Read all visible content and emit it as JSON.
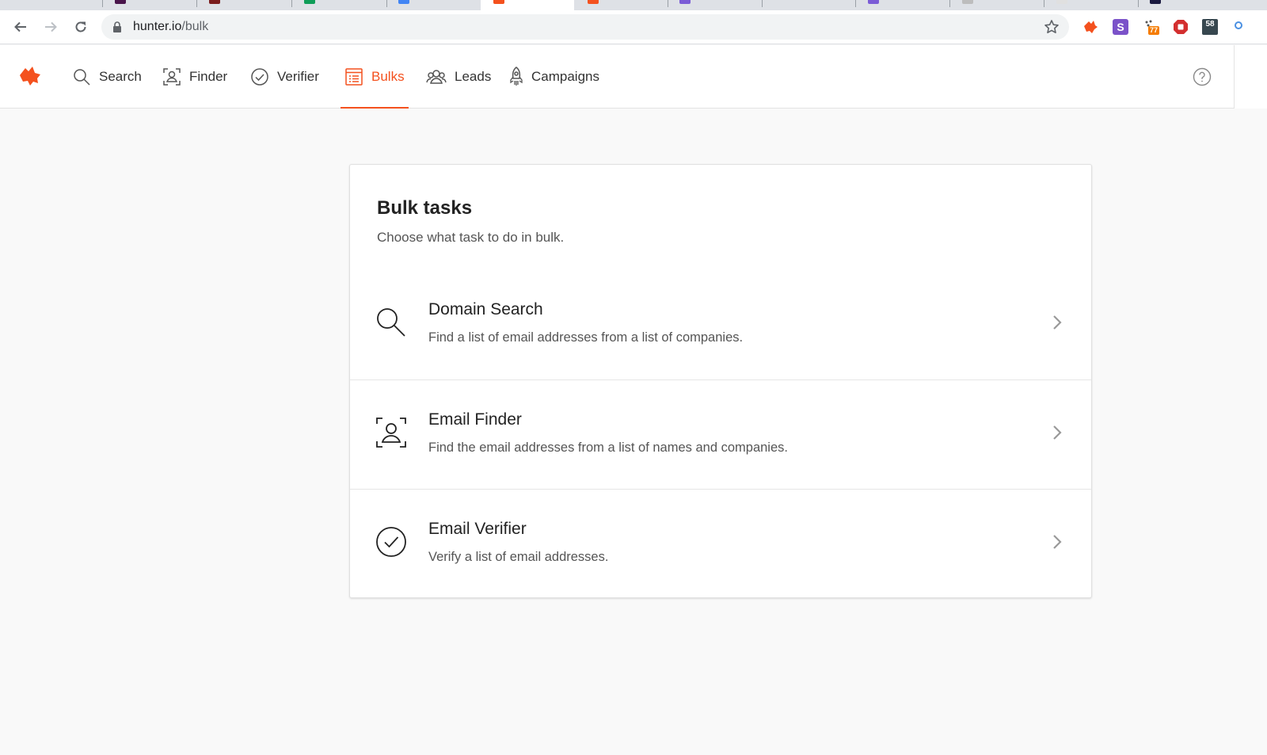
{
  "browser": {
    "url_host": "hunter.io",
    "url_path": "/bulk",
    "extensions": [
      {
        "name": "hunter-extension-icon"
      },
      {
        "name": "s-extension-icon",
        "label": "S"
      },
      {
        "name": "tracker-extension-icon",
        "badge": "77"
      },
      {
        "name": "adblock-extension-icon"
      },
      {
        "name": "counter-extension-icon",
        "label": "58"
      }
    ]
  },
  "nav": {
    "items": [
      {
        "label": "Search",
        "icon": "search-icon"
      },
      {
        "label": "Finder",
        "icon": "finder-icon"
      },
      {
        "label": "Verifier",
        "icon": "verifier-icon"
      },
      {
        "label": "Bulks",
        "icon": "bulks-icon",
        "active": true
      },
      {
        "label": "Leads",
        "icon": "leads-icon"
      },
      {
        "label": "Campaigns",
        "icon": "rocket-icon"
      }
    ]
  },
  "card": {
    "title": "Bulk tasks",
    "subtitle": "Choose what task to do in bulk.",
    "tasks": [
      {
        "title": "Domain Search",
        "description": "Find a list of email addresses from a list of companies.",
        "icon": "magnifier-icon"
      },
      {
        "title": "Email Finder",
        "description": "Find the email addresses from a list of names and companies.",
        "icon": "person-frame-icon"
      },
      {
        "title": "Email Verifier",
        "description": "Verify a list of email addresses.",
        "icon": "check-circle-icon"
      }
    ]
  },
  "colors": {
    "accent": "#f4511e",
    "background": "#f9f9f9",
    "text": "#222222"
  }
}
